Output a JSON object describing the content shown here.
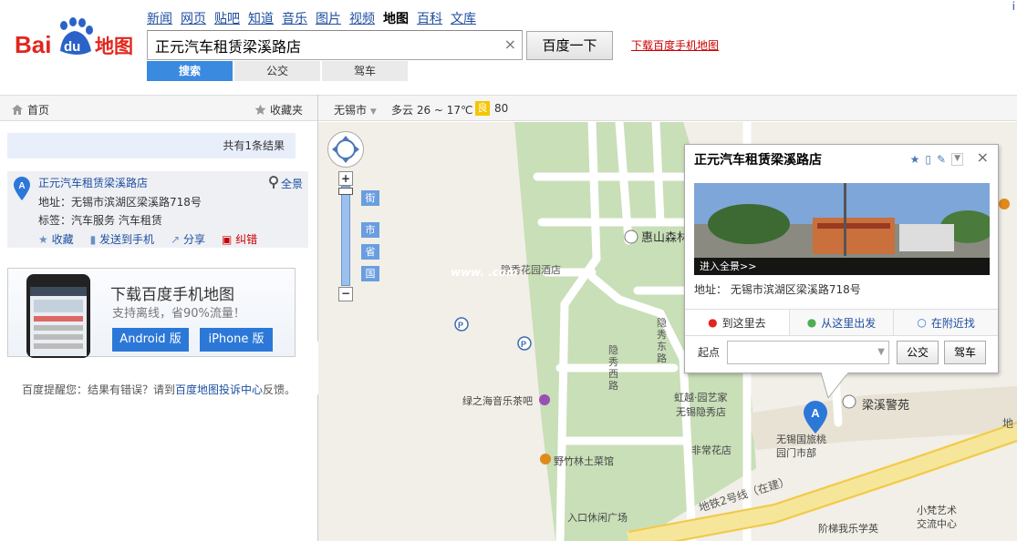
{
  "logo": {
    "text_bai": "Bai",
    "text_du": "du",
    "text_map": "地图"
  },
  "nav": {
    "items": [
      "新闻",
      "网页",
      "贴吧",
      "知道",
      "音乐",
      "图片",
      "视频",
      "地图",
      "百科",
      "文库"
    ],
    "current": "地图"
  },
  "top_right": "i",
  "search": {
    "value": "正元汽车租赁梁溪路店",
    "clear": "×",
    "button": "百度一下"
  },
  "download_link": "下载百度手机地图",
  "search_tabs": [
    "搜索",
    "公交",
    "驾车"
  ],
  "left_bar": {
    "home": "首页",
    "favorites": "收藏夹"
  },
  "right_bar": {
    "city": "无锡市",
    "weather": "多云 26 ~ 17℃",
    "aqi_badge": "良",
    "aqi_value": "80"
  },
  "result_count": "共有1条结果",
  "result": {
    "marker": "A",
    "title": "正元汽车租赁梁溪路店",
    "panorama": "全景",
    "address": "地址：无锡市滨湖区梁溪路718号",
    "tags": "标签：汽车服务 汽车租赁",
    "actions": [
      "收藏",
      "发送到手机",
      "分享",
      "纠错"
    ]
  },
  "ad": {
    "title": "下载百度手机地图",
    "subtitle": "支持离线，省90%流量！",
    "android": "Android 版",
    "iphone": "iPhone 版"
  },
  "note": {
    "pre": "百度提醒您：结果有错误？请到",
    "link": "百度地图投诉中心",
    "post": "反馈。"
  },
  "map": {
    "zoom_levels": [
      "街",
      "市",
      "省",
      "国"
    ],
    "zoom_in": "+",
    "zoom_out": "−",
    "labels": {
      "huishan": "惠山森林",
      "hotel": "隐秀花园酒店",
      "yinxiu_east": "隐秀东路",
      "yinxiu_west": "隐秀西路",
      "tea": "绿之海音乐茶吧",
      "garden": "虹越·园艺家",
      "garden2": "无锡隐秀店",
      "liangxi": "梁溪警苑",
      "park": "无锡国旅桃",
      "park2": "园门市部",
      "flower": "非常花店",
      "yezhu": "野竹林土菜馆",
      "square": "入口休闲广场",
      "metro": "地铁2号线（在建）",
      "metro2": "地",
      "music": "阶梯我乐学英",
      "xiaofan": "小梵艺术",
      "xiaofan2": "交流中心",
      "watermark": "www.                   .com"
    },
    "marker": "A"
  },
  "popup": {
    "title": "正元汽车租赁梁溪路店",
    "close": "×",
    "panorama_text": "进入全景>>",
    "address": "地址： 无锡市滨湖区梁溪路718号",
    "tabs": [
      "到这里去",
      "从这里出发",
      "在附近找"
    ],
    "start_label": "起点",
    "bus": "公交",
    "drive": "驾车"
  },
  "colors": {
    "brand_blue": "#2c78d8",
    "link": "#1f4fa0",
    "baidu_red": "#e1261c"
  }
}
